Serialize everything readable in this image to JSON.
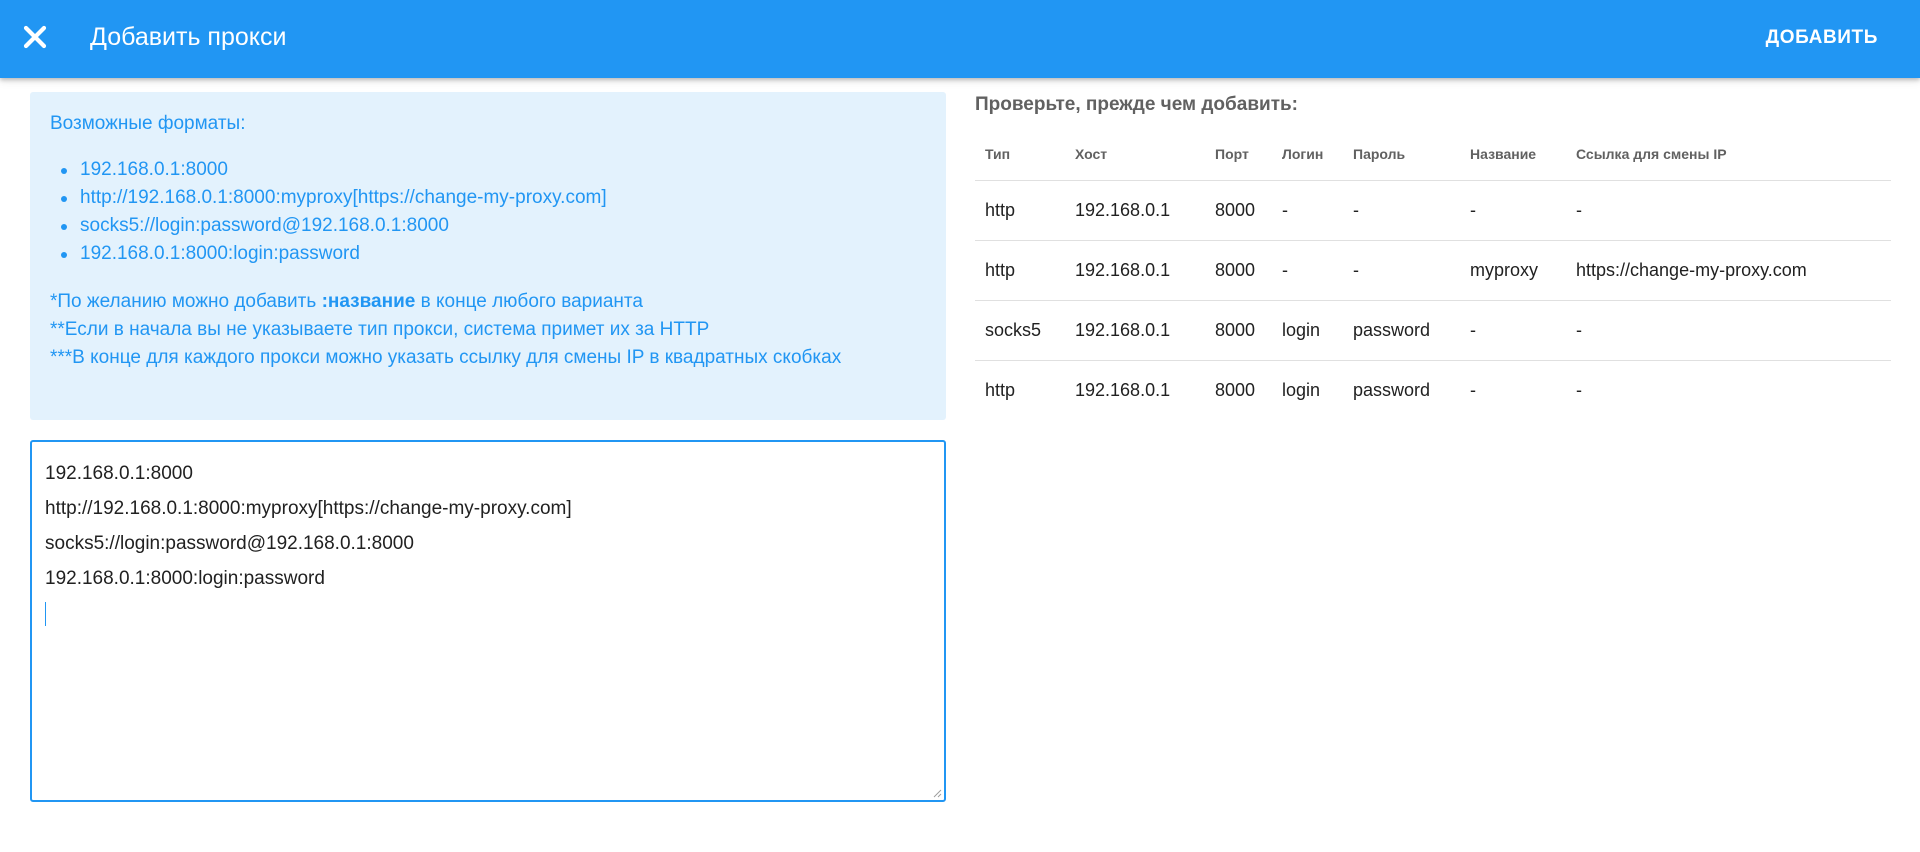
{
  "header": {
    "title": "Добавить прокси",
    "add_label": "ДОБАВИТЬ",
    "close_icon": "close-icon"
  },
  "colors": {
    "primary": "#2196f3",
    "info_bg": "#e3f2fd"
  },
  "info": {
    "title": "Возможные форматы:",
    "formats": [
      "192.168.0.1:8000",
      "http://192.168.0.1:8000:myproxy[https://change-my-proxy.com]",
      "socks5://login:password@192.168.0.1:8000",
      "192.168.0.1:8000:login:password"
    ],
    "note1_pre": "*По желанию можно добавить ",
    "note1_bold": ":название",
    "note1_post": " в конце любого варианта",
    "note2": "**Если в начала вы не указываете тип прокси, система примет их за HTTP",
    "note3": "***В конце для каждого прокси можно указать ссылку для смены IP в квадратных скобках"
  },
  "input": {
    "lines": [
      "192.168.0.1:8000",
      "http://192.168.0.1:8000:myproxy[https://change-my-proxy.com]",
      "socks5://login:password@192.168.0.1:8000",
      "192.168.0.1:8000:login:password"
    ]
  },
  "check": {
    "title": "Проверьте, прежде чем добавить:",
    "columns": [
      "Тип",
      "Хост",
      "Порт",
      "Логин",
      "Пароль",
      "Название",
      "Ссылка для смены IP"
    ],
    "rows": [
      [
        "http",
        "192.168.0.1",
        "8000",
        "-",
        "-",
        "-",
        "-"
      ],
      [
        "http",
        "192.168.0.1",
        "8000",
        "-",
        "-",
        "myproxy",
        "https://change-my-proxy.com"
      ],
      [
        "socks5",
        "192.168.0.1",
        "8000",
        "login",
        "password",
        "-",
        "-"
      ],
      [
        "http",
        "192.168.0.1",
        "8000",
        "login",
        "password",
        "-",
        "-"
      ]
    ]
  }
}
